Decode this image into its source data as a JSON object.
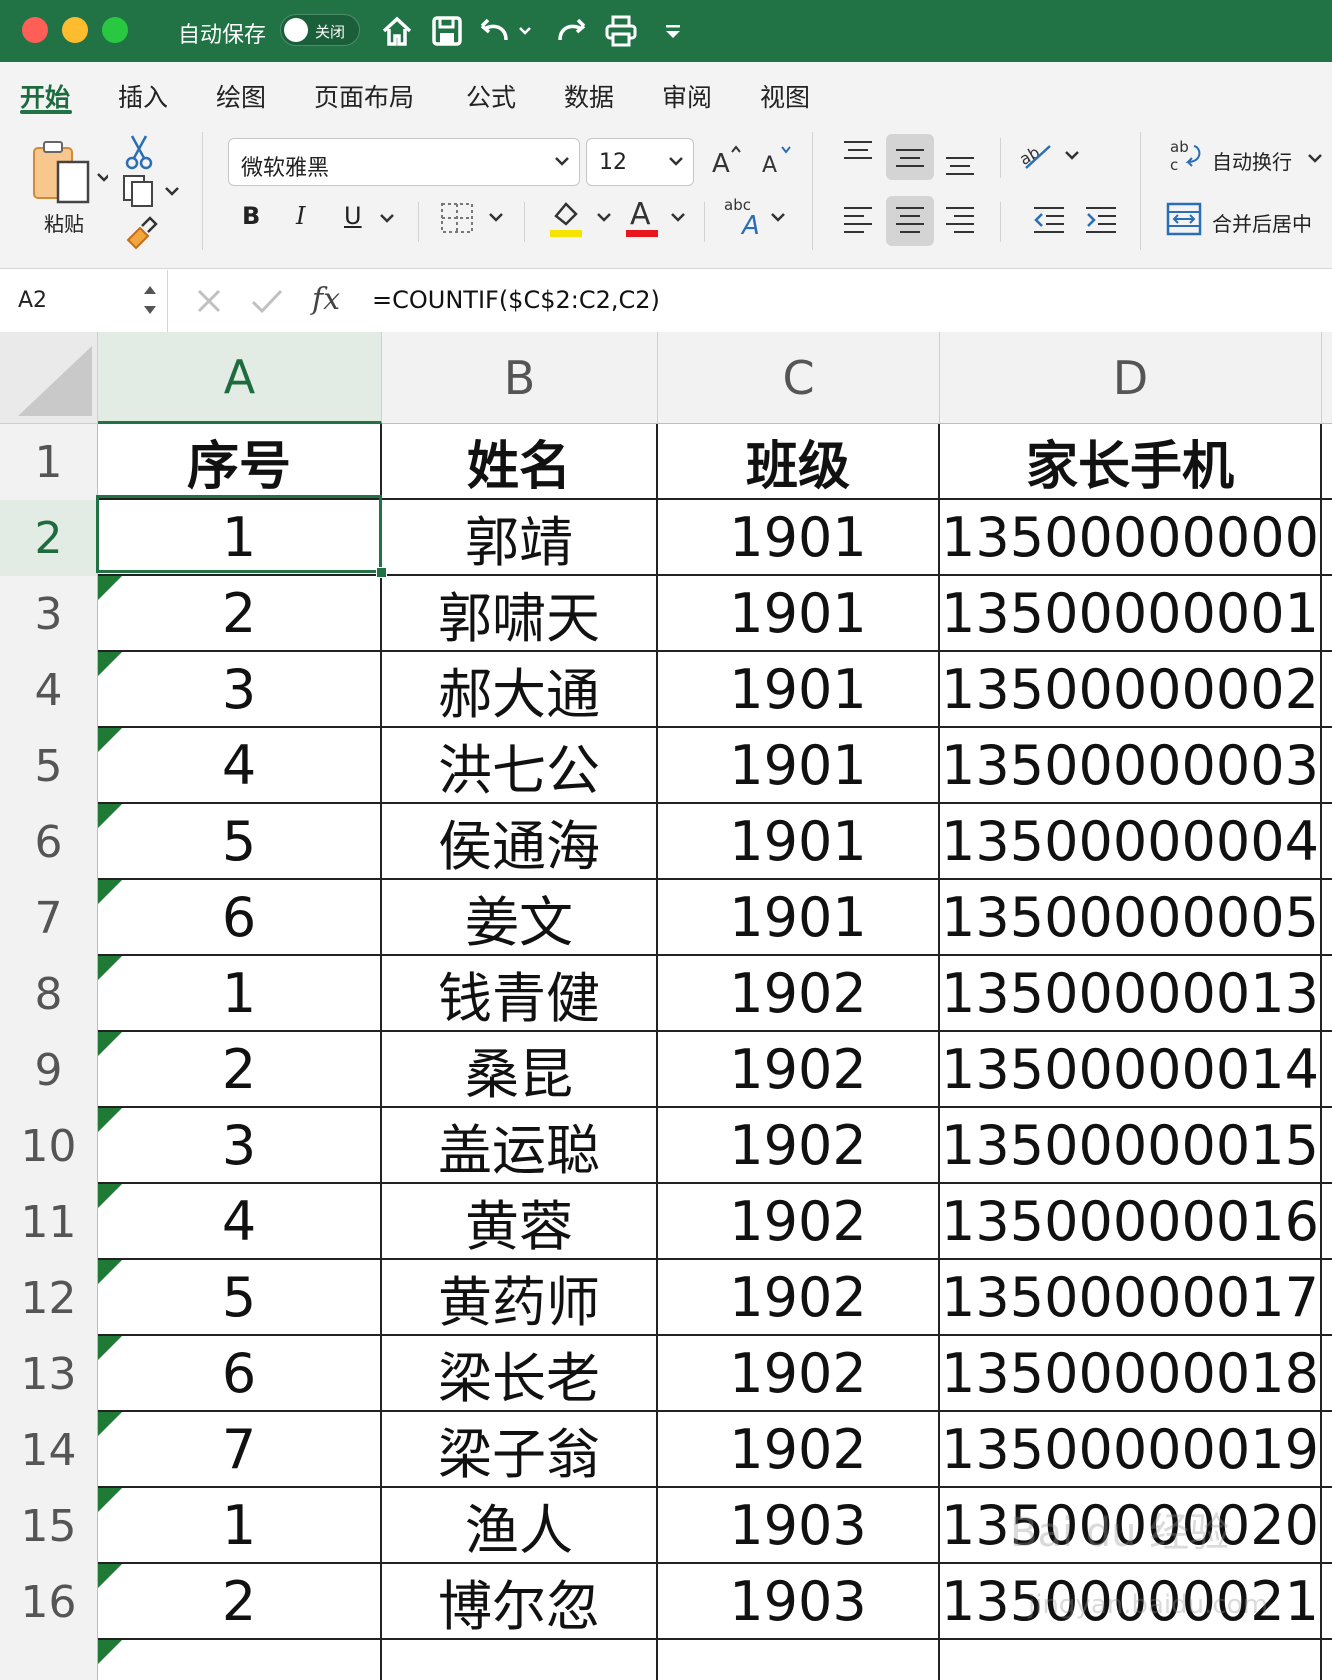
{
  "titlebar": {
    "autosave_label": "自动保存",
    "toggle_label": "关闭"
  },
  "menu": {
    "tabs": [
      "开始",
      "插入",
      "绘图",
      "页面布局",
      "公式",
      "数据",
      "审阅",
      "视图"
    ]
  },
  "ribbon": {
    "paste_label": "粘贴",
    "font_name": "微软雅黑",
    "font_size": "12",
    "bold": "B",
    "italic": "I",
    "underline": "U",
    "wrap_text_label": "自动换行",
    "merge_center_label": "合并后居中",
    "font_color": "#e8161c",
    "highlight_color": "#f5e400"
  },
  "formula_bar": {
    "name_box": "A2",
    "formula": "=COUNTIF($C$2:C2,C2)"
  },
  "sheet": {
    "columns": [
      "A",
      "B",
      "C",
      "D"
    ],
    "selected_column": "A",
    "selected_cell": "A2",
    "rows": [
      {
        "n": "1",
        "a": "序号",
        "b": "姓名",
        "c": "班级",
        "d": "家长手机"
      },
      {
        "n": "2",
        "a": "1",
        "b": "郭靖",
        "c": "1901",
        "d": "13500000000"
      },
      {
        "n": "3",
        "a": "2",
        "b": "郭啸天",
        "c": "1901",
        "d": "13500000001"
      },
      {
        "n": "4",
        "a": "3",
        "b": "郝大通",
        "c": "1901",
        "d": "13500000002"
      },
      {
        "n": "5",
        "a": "4",
        "b": "洪七公",
        "c": "1901",
        "d": "13500000003"
      },
      {
        "n": "6",
        "a": "5",
        "b": "侯通海",
        "c": "1901",
        "d": "13500000004"
      },
      {
        "n": "7",
        "a": "6",
        "b": "姜文",
        "c": "1901",
        "d": "13500000005"
      },
      {
        "n": "8",
        "a": "1",
        "b": "钱青健",
        "c": "1902",
        "d": "13500000013"
      },
      {
        "n": "9",
        "a": "2",
        "b": "桑昆",
        "c": "1902",
        "d": "13500000014"
      },
      {
        "n": "10",
        "a": "3",
        "b": "盖运聪",
        "c": "1902",
        "d": "13500000015"
      },
      {
        "n": "11",
        "a": "4",
        "b": "黄蓉",
        "c": "1902",
        "d": "13500000016"
      },
      {
        "n": "12",
        "a": "5",
        "b": "黄药师",
        "c": "1902",
        "d": "13500000017"
      },
      {
        "n": "13",
        "a": "6",
        "b": "梁长老",
        "c": "1902",
        "d": "13500000018"
      },
      {
        "n": "14",
        "a": "7",
        "b": "梁子翁",
        "c": "1902",
        "d": "13500000019"
      },
      {
        "n": "15",
        "a": "1",
        "b": "渔人",
        "c": "1903",
        "d": "13500000020"
      },
      {
        "n": "16",
        "a": "2",
        "b": "博尔忽",
        "c": "1903",
        "d": "13500000021"
      }
    ]
  },
  "watermark": {
    "brand": "Bai du 经验",
    "url": "jingyan.baidu.com"
  }
}
